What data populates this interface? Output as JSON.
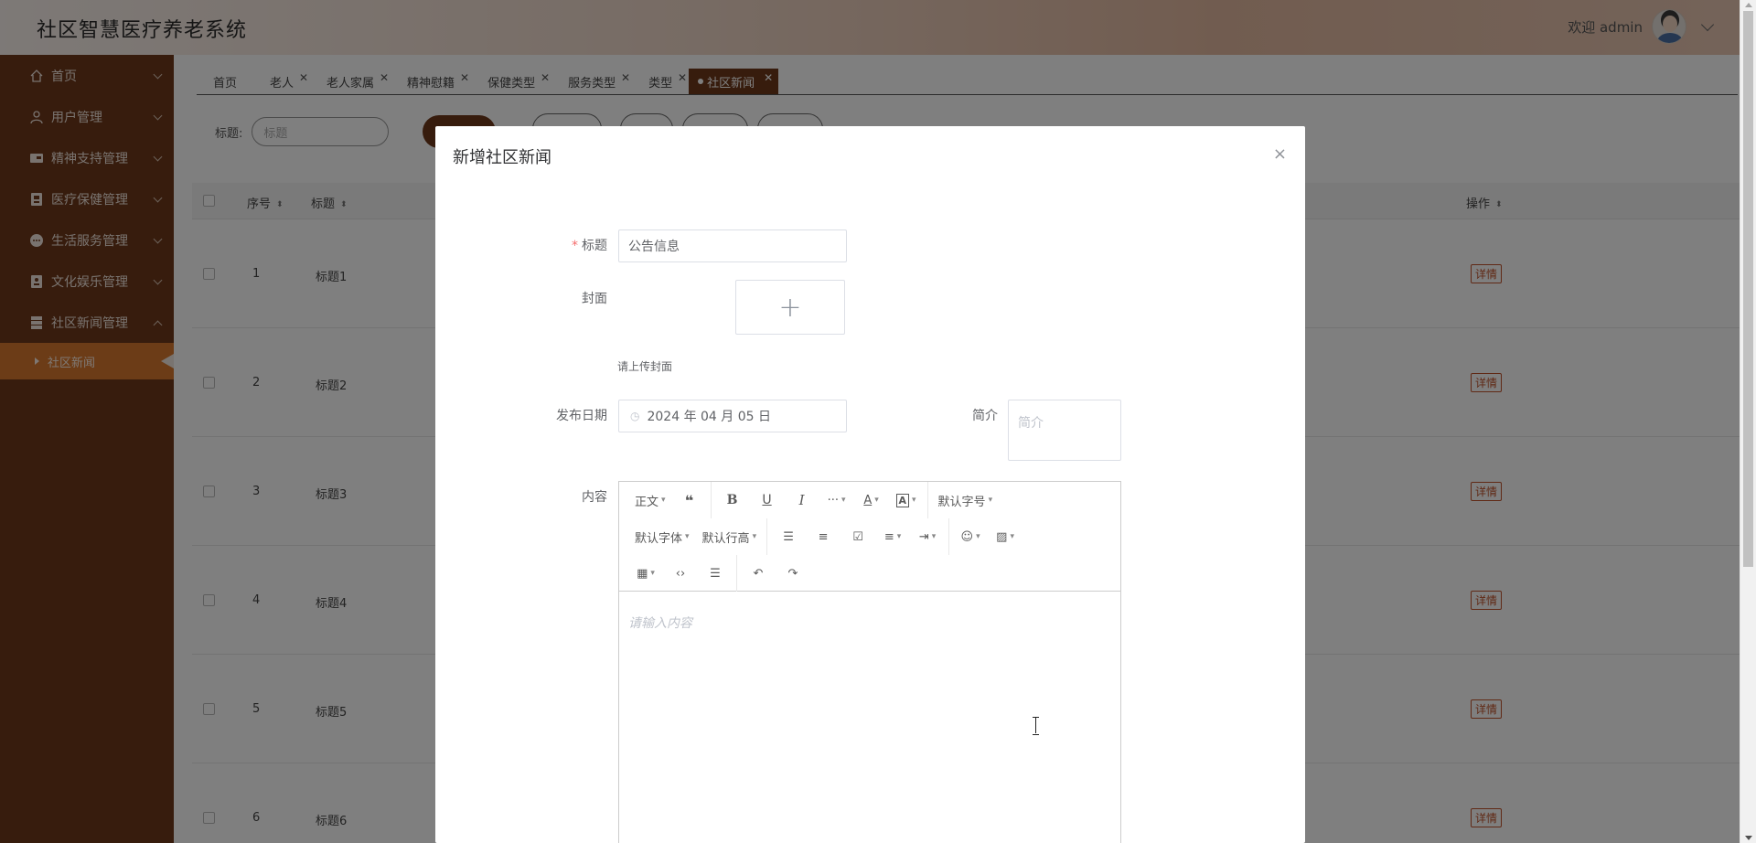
{
  "app": {
    "title": "社区智慧医疗养老系统",
    "welcome": "欢迎 admin"
  },
  "sidebar": {
    "items": [
      {
        "label": "首页",
        "icon": "home-icon",
        "glyph": "⌂"
      },
      {
        "label": "用户管理",
        "icon": "user-icon",
        "glyph": "☺"
      },
      {
        "label": "精神支持管理",
        "icon": "chat-icon",
        "glyph": "▣"
      },
      {
        "label": "医疗保健管理",
        "icon": "medical-icon",
        "glyph": "▤"
      },
      {
        "label": "生活服务管理",
        "icon": "service-icon",
        "glyph": "●"
      },
      {
        "label": "文化娱乐管理",
        "icon": "culture-icon",
        "glyph": "▦"
      },
      {
        "label": "社区新闻管理",
        "icon": "news-icon",
        "glyph": "▥"
      }
    ],
    "active_sub": "社区新闻"
  },
  "tabs": [
    {
      "label": "首页",
      "closable": false
    },
    {
      "label": "老人",
      "closable": true
    },
    {
      "label": "老人家属",
      "closable": true
    },
    {
      "label": "精神慰籍",
      "closable": true
    },
    {
      "label": "保健类型",
      "closable": true
    },
    {
      "label": "服务类型",
      "closable": true
    },
    {
      "label": "类型",
      "closable": true
    },
    {
      "label": "社区新闻",
      "closable": true,
      "active": true
    }
  ],
  "search": {
    "label": "标题:",
    "placeholder": "标题"
  },
  "table": {
    "headers": {
      "index": "序号",
      "title": "标题",
      "action": "操作"
    },
    "rows": [
      {
        "index": "1",
        "title": "标题1",
        "action": "详情"
      },
      {
        "index": "2",
        "title": "标题2",
        "action": "详情"
      },
      {
        "index": "3",
        "title": "标题3",
        "action": "详情"
      },
      {
        "index": "4",
        "title": "标题4",
        "action": "详情"
      },
      {
        "index": "5",
        "title": "标题5",
        "action": "详情"
      },
      {
        "index": "6",
        "title": "标题6",
        "action": "详情"
      }
    ]
  },
  "dialog": {
    "title": "新增社区新闻",
    "close": "×",
    "fields": {
      "title_label": "标题",
      "title_value": "公告信息",
      "cover_label": "封面",
      "cover_hint": "请上传封面",
      "date_label": "发布日期",
      "date_value": "2024 年 04 月 05 日",
      "summary_label": "简介",
      "summary_placeholder": "简介",
      "content_label": "内容",
      "content_placeholder": "请输入内容"
    },
    "toolbar": {
      "paragraph": "正文",
      "font_size": "默认字号",
      "font_family": "默认字体",
      "line_height": "默认行高"
    }
  },
  "colors": {
    "sidebar": "#6e391b",
    "active_sub": "#d9782e",
    "accent": "#c0522a"
  }
}
